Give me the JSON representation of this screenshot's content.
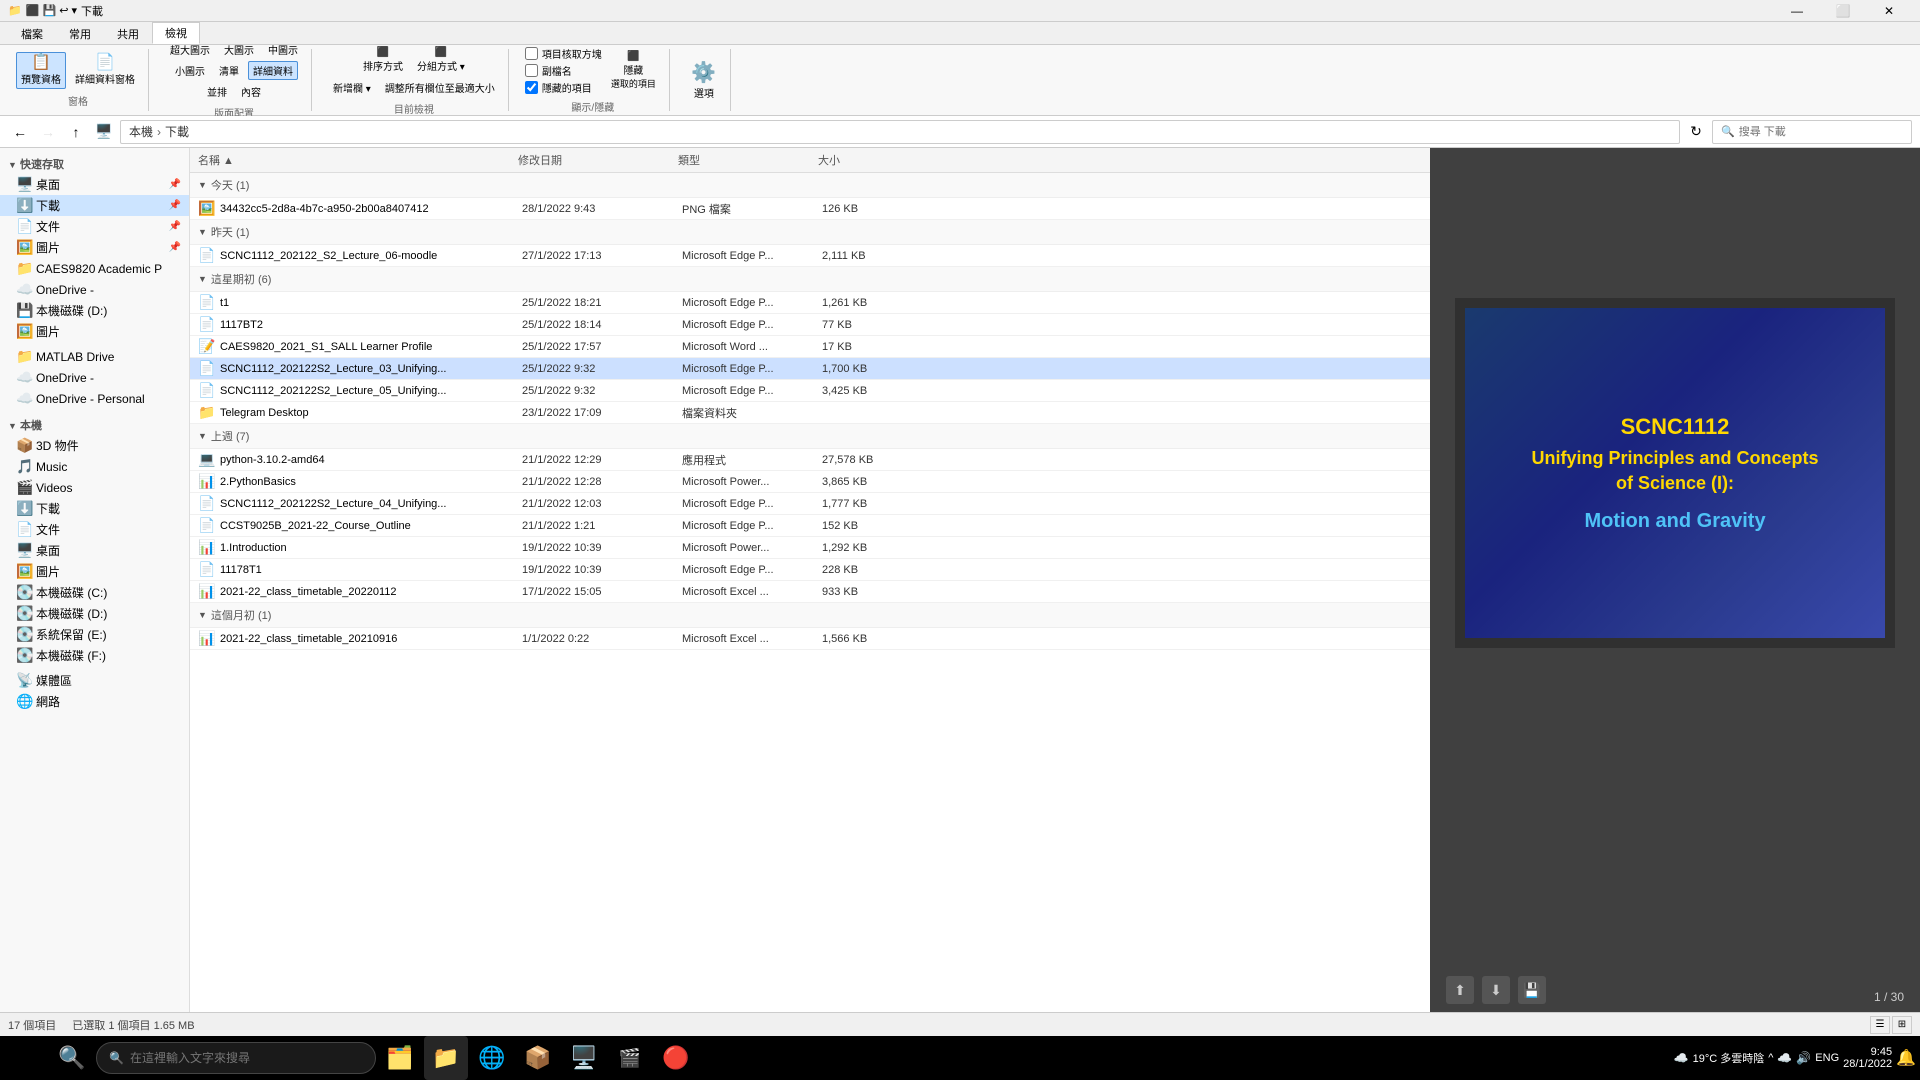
{
  "titleBar": {
    "leftIcons": [
      "⬛",
      "💾",
      "↩"
    ],
    "title": "下載",
    "controls": [
      "—",
      "⬜",
      "✕"
    ]
  },
  "ribbonTabs": [
    "檔案",
    "常用",
    "共用",
    "檢視"
  ],
  "activeTab": "檢視",
  "ribbonGroups": {
    "窗格": {
      "label": "窗格",
      "buttons": [
        "預覽資格",
        "詳細資料窗格"
      ]
    },
    "版面配置": {
      "label": "版面配置",
      "buttons": [
        "超大圖示",
        "大圖示",
        "中圖示",
        "小圖示",
        "清單",
        "詳細資料",
        "並排",
        "內容"
      ]
    },
    "目前檢視": {
      "label": "目前檢視",
      "buttons": [
        "排序方式",
        "分組方式",
        "新增欄▼",
        "調整所有欄位至最適大小"
      ]
    },
    "顯示/隱藏": {
      "label": "顯示/隱藏",
      "checkboxes": [
        "項目核取方塊",
        "副檔名",
        "隱藏的項目"
      ],
      "buttons": [
        "隱藏選取的項目"
      ]
    },
    "選項": {
      "label": "",
      "buttons": [
        "選項"
      ]
    }
  },
  "addressBar": {
    "path": [
      "本機",
      "下載"
    ],
    "searchPlaceholder": "搜尋 下載"
  },
  "sidebar": {
    "quickAccess": {
      "label": "快速存取",
      "items": [
        {
          "name": "桌面",
          "icon": "🖥️",
          "pinned": true
        },
        {
          "name": "下載",
          "icon": "⬇️",
          "pinned": true,
          "active": true
        },
        {
          "name": "文件",
          "icon": "📄",
          "pinned": true
        },
        {
          "name": "圖片",
          "icon": "🖼️",
          "pinned": true
        },
        {
          "name": "CAES9820 Academic P",
          "icon": "📁"
        },
        {
          "name": "OneDrive -",
          "icon": "☁️"
        },
        {
          "name": "本機磁碟 (D:)",
          "icon": "💾"
        },
        {
          "name": "圖片",
          "icon": "🖼️"
        }
      ]
    },
    "other": [
      {
        "name": "MATLAB Drive",
        "icon": "📁"
      },
      {
        "name": "OneDrive -",
        "icon": "☁️"
      },
      {
        "name": "OneDrive - Personal",
        "icon": "☁️"
      }
    ],
    "thisPC": {
      "label": "本機",
      "items": [
        {
          "name": "3D 物件",
          "icon": "📦"
        },
        {
          "name": "Music",
          "icon": "🎵"
        },
        {
          "name": "Videos",
          "icon": "🎬"
        },
        {
          "name": "下載",
          "icon": "⬇️"
        },
        {
          "name": "文件",
          "icon": "📄"
        },
        {
          "name": "桌面",
          "icon": "🖥️"
        },
        {
          "name": "圖片",
          "icon": "🖼️"
        },
        {
          "name": "本機磁碟 (C:)",
          "icon": "💽"
        },
        {
          "name": "本機磁碟 (D:)",
          "icon": "💽"
        },
        {
          "name": "系統保留 (E:)",
          "icon": "💽"
        },
        {
          "name": "本機磁碟 (F:)",
          "icon": "💽"
        }
      ]
    },
    "network": [
      {
        "name": "媒體區",
        "icon": "📡"
      },
      {
        "name": "網路",
        "icon": "🌐"
      }
    ]
  },
  "fileList": {
    "columns": [
      "名稱",
      "修改日期",
      "類型",
      "大小"
    ],
    "groups": [
      {
        "label": "今天 (1)",
        "files": [
          {
            "name": "34432cc5-2d8a-4b7c-a950-2b00a8407412",
            "date": "28/1/2022 9:43",
            "type": "PNG 檔案",
            "size": "126 KB",
            "icon": "🖼️",
            "iconClass": "icon-png"
          }
        ]
      },
      {
        "label": "昨天 (1)",
        "files": [
          {
            "name": "SCNC1112_202122_S2_Lecture_06-moodle",
            "date": "27/1/2022 17:13",
            "type": "Microsoft Edge P...",
            "size": "2,111 KB",
            "icon": "📄",
            "iconClass": "icon-pdf"
          }
        ]
      },
      {
        "label": "這星期初 (6)",
        "files": [
          {
            "name": "t1",
            "date": "25/1/2022 18:21",
            "type": "Microsoft Edge P...",
            "size": "1,261 KB",
            "icon": "📄",
            "iconClass": "icon-pdf"
          },
          {
            "name": "1117BT2",
            "date": "25/1/2022 18:14",
            "type": "Microsoft Edge P...",
            "size": "77 KB",
            "icon": "📄",
            "iconClass": "icon-pdf"
          },
          {
            "name": "CAES9820_2021_S1_SALL Learner Profile",
            "date": "25/1/2022 17:57",
            "type": "Microsoft Word ...",
            "size": "17 KB",
            "icon": "📝",
            "iconClass": "icon-word"
          },
          {
            "name": "SCNC1112_202122S2_Lecture_03_Unifying...",
            "date": "25/1/2022 9:32",
            "type": "Microsoft Edge P...",
            "size": "1,700 KB",
            "icon": "📄",
            "iconClass": "icon-pdf",
            "selected": true
          },
          {
            "name": "SCNC1112_202122S2_Lecture_05_Unifying...",
            "date": "25/1/2022 9:32",
            "type": "Microsoft Edge P...",
            "size": "3,425 KB",
            "icon": "📄",
            "iconClass": "icon-pdf"
          },
          {
            "name": "Telegram Desktop",
            "date": "23/1/2022 17:09",
            "type": "檔案資料夾",
            "size": "",
            "icon": "📁",
            "iconClass": "icon-folder"
          }
        ]
      },
      {
        "label": "上週 (7)",
        "files": [
          {
            "name": "python-3.10.2-amd64",
            "date": "21/1/2022 12:29",
            "type": "應用程式",
            "size": "27,578 KB",
            "icon": "💻",
            "iconClass": "icon-exe"
          },
          {
            "name": "2.PythonBasics",
            "date": "21/1/2022 12:28",
            "type": "Microsoft Power...",
            "size": "3,865 KB",
            "icon": "📊",
            "iconClass": "icon-pptx"
          },
          {
            "name": "SCNC1112_202122S2_Lecture_04_Unifying...",
            "date": "21/1/2022 12:03",
            "type": "Microsoft Edge P...",
            "size": "1,777 KB",
            "icon": "📄",
            "iconClass": "icon-pdf"
          },
          {
            "name": "CCST9025B_2021-22_Course_Outline",
            "date": "21/1/2022 1:21",
            "type": "Microsoft Edge P...",
            "size": "152 KB",
            "icon": "📄",
            "iconClass": "icon-pdf"
          },
          {
            "name": "1.Introduction",
            "date": "19/1/2022 10:39",
            "type": "Microsoft Power...",
            "size": "1,292 KB",
            "icon": "📊",
            "iconClass": "icon-pptx"
          },
          {
            "name": "11178T1",
            "date": "19/1/2022 10:39",
            "type": "Microsoft Edge P...",
            "size": "228 KB",
            "icon": "📄",
            "iconClass": "icon-pdf"
          },
          {
            "name": "2021-22_class_timetable_20220112",
            "date": "17/1/2022 15:05",
            "type": "Microsoft Excel ...",
            "size": "933 KB",
            "icon": "📊",
            "iconClass": "icon-excel"
          }
        ]
      },
      {
        "label": "這個月初 (1)",
        "files": [
          {
            "name": "2021-22_class_timetable_20210916",
            "date": "1/1/2022 0:22",
            "type": "Microsoft Excel ...",
            "size": "1,566 KB",
            "icon": "📊",
            "iconClass": "icon-excel"
          }
        ]
      }
    ]
  },
  "preview": {
    "slide": {
      "line1": "SCNC1112",
      "line2": "Unifying Principles and Concepts",
      "line3": "of Science (I):",
      "line4": "Motion and Gravity"
    },
    "page": "1 / 30"
  },
  "statusBar": {
    "itemCount": "17 個項目",
    "selectedInfo": "已選取 1 個項目  1.65 MB"
  },
  "taskbar": {
    "searchPlaceholder": "在這裡輸入文字來搜尋",
    "apps": [
      "⊞",
      "🔍",
      "🗂️",
      "🔥",
      "🌐",
      "📦",
      "🖥️",
      "🎬",
      "🔴"
    ],
    "systemTray": {
      "weather": "19°C 多雲時陰",
      "icons": [
        "^",
        "☁️",
        "🔊",
        "ENG"
      ],
      "time": "9:45",
      "date": "28/1/2022"
    }
  }
}
